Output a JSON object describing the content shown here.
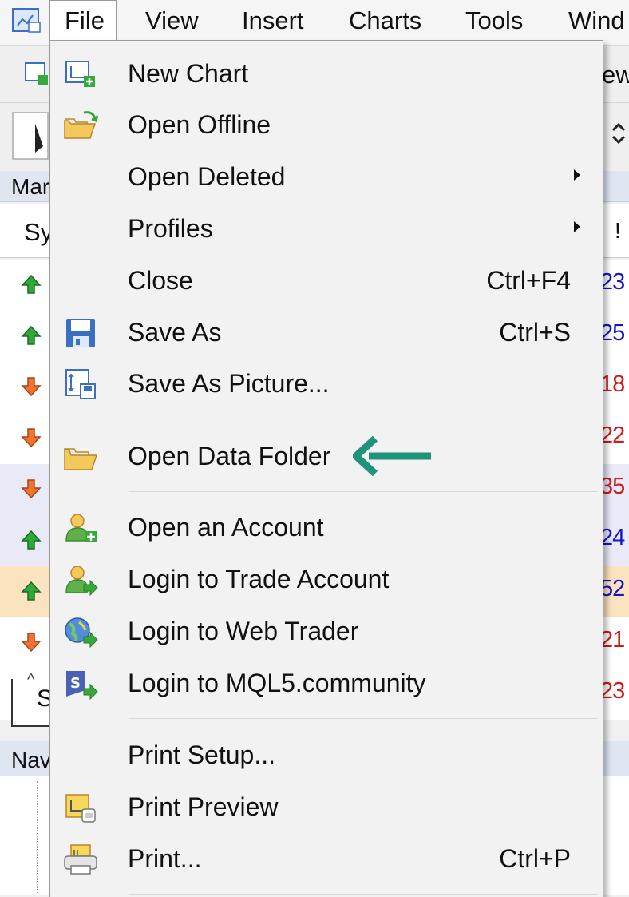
{
  "menubar": {
    "items": [
      "File",
      "View",
      "Insert",
      "Charts",
      "Tools",
      "Wind"
    ]
  },
  "background": {
    "toolbar_fragment": "ew",
    "market_watch_header": "Mar",
    "column_header": "Sy",
    "column_right": "!",
    "rows": [
      {
        "dir": "up",
        "val": "23"
      },
      {
        "dir": "up",
        "val": "25"
      },
      {
        "dir": "down",
        "val": "18"
      },
      {
        "dir": "down",
        "val": "22"
      },
      {
        "dir": "down",
        "val": "35"
      },
      {
        "dir": "up",
        "val": "24"
      },
      {
        "dir": "up",
        "val": "52"
      },
      {
        "dir": "down",
        "val": "21"
      },
      {
        "dir": "down",
        "val": "23"
      }
    ],
    "tab_fragment": "S",
    "navigator_header": "Nav"
  },
  "file_menu": {
    "new_chart": "New Chart",
    "open_offline": "Open Offline",
    "open_deleted": "Open Deleted",
    "profiles": "Profiles",
    "close": "Close",
    "close_shortcut": "Ctrl+F4",
    "save_as": "Save As",
    "save_as_shortcut": "Ctrl+S",
    "save_as_picture": "Save As Picture...",
    "open_data_folder": "Open Data Folder",
    "open_account": "Open an Account",
    "login_trade": "Login to Trade Account",
    "login_web": "Login to Web Trader",
    "login_mql5": "Login to MQL5.community",
    "print_setup": "Print Setup...",
    "print_preview": "Print Preview",
    "print": "Print...",
    "print_shortcut": "Ctrl+P"
  },
  "colors": {
    "callout_arrow": "#1f9478",
    "up_text": "#1515cc",
    "down_text": "#d21a1a",
    "row_highlight": "#e9e9f7",
    "row_selected": "#fbe3c0"
  }
}
